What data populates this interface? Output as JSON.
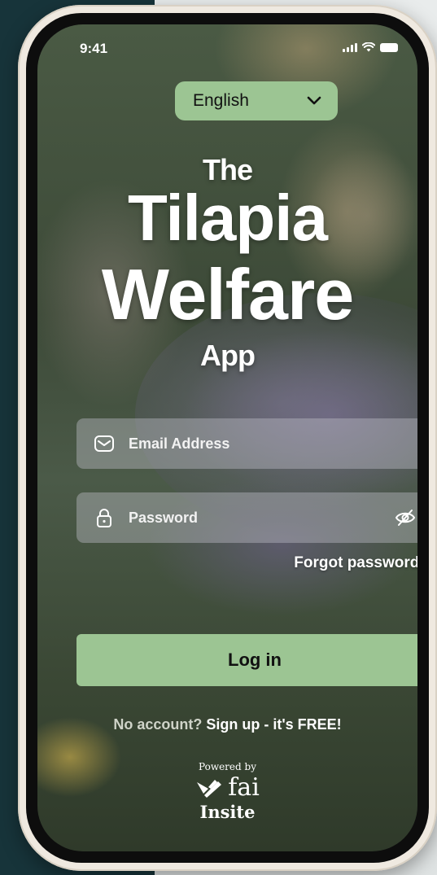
{
  "status_bar": {
    "time": "9:41"
  },
  "language_selector": {
    "selected": "English"
  },
  "app_title": {
    "line1": "The",
    "line2": "Tilapia",
    "line3": "Welfare",
    "line4": "App"
  },
  "login_form": {
    "email_placeholder": "Email Address",
    "password_placeholder": "Password",
    "forgot_password": "Forgot password?",
    "login_button": "Log in"
  },
  "signup": {
    "prompt": "No account?",
    "link": "Sign up - it's FREE!"
  },
  "footer": {
    "powered_by": "Powered by",
    "brand_name": "fai",
    "brand_sub": "Insite"
  },
  "colors": {
    "accent_green": "#9cc593",
    "background_teal": "#17343a",
    "frame": "#efe9e0"
  },
  "icons": [
    "mail-icon",
    "lock-icon",
    "eye-slash-icon",
    "chevron-down-icon",
    "signal-icon",
    "wifi-icon",
    "battery-icon",
    "fai-logo-icon"
  ]
}
